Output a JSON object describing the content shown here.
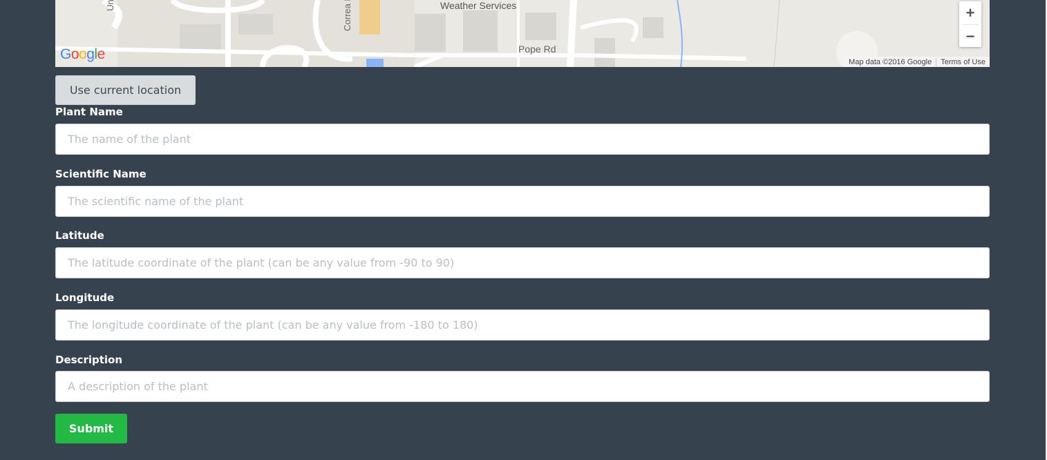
{
  "map": {
    "place_label": "Weather Services",
    "street_labels": {
      "pope": "Pope Rd",
      "correa": "Correa Rd",
      "university": "Un"
    },
    "logo_text": "Google",
    "attribution": {
      "data": "Map data ©2016 Google",
      "terms": "Terms of Use"
    },
    "zoom_in": "+",
    "zoom_out": "−",
    "colors": {
      "background": "#ebe9e4",
      "road": "#ffffff",
      "building": "#d8d6d1",
      "campus": "#e3e1da",
      "water": "#8ab4f8",
      "highlight": "#f3c66c"
    }
  },
  "location_button": "Use current location",
  "form": {
    "plant_name": {
      "label": "Plant Name",
      "placeholder": "The name of the plant"
    },
    "scientific_name": {
      "label": "Scientific Name",
      "placeholder": "The scientific name of the plant"
    },
    "latitude": {
      "label": "Latitude",
      "placeholder": "The latitude coordinate of the plant (can be any value from -90 to 90)"
    },
    "longitude": {
      "label": "Longitude",
      "placeholder": "The longitude coordinate of the plant (can be any value from -180 to 180)"
    },
    "description": {
      "label": "Description",
      "placeholder": "A description of the plant"
    },
    "submit": "Submit"
  },
  "colors": {
    "page_background": "#36434f",
    "submit_button": "#22ba44",
    "secondary_button": "#d9dcdf"
  }
}
